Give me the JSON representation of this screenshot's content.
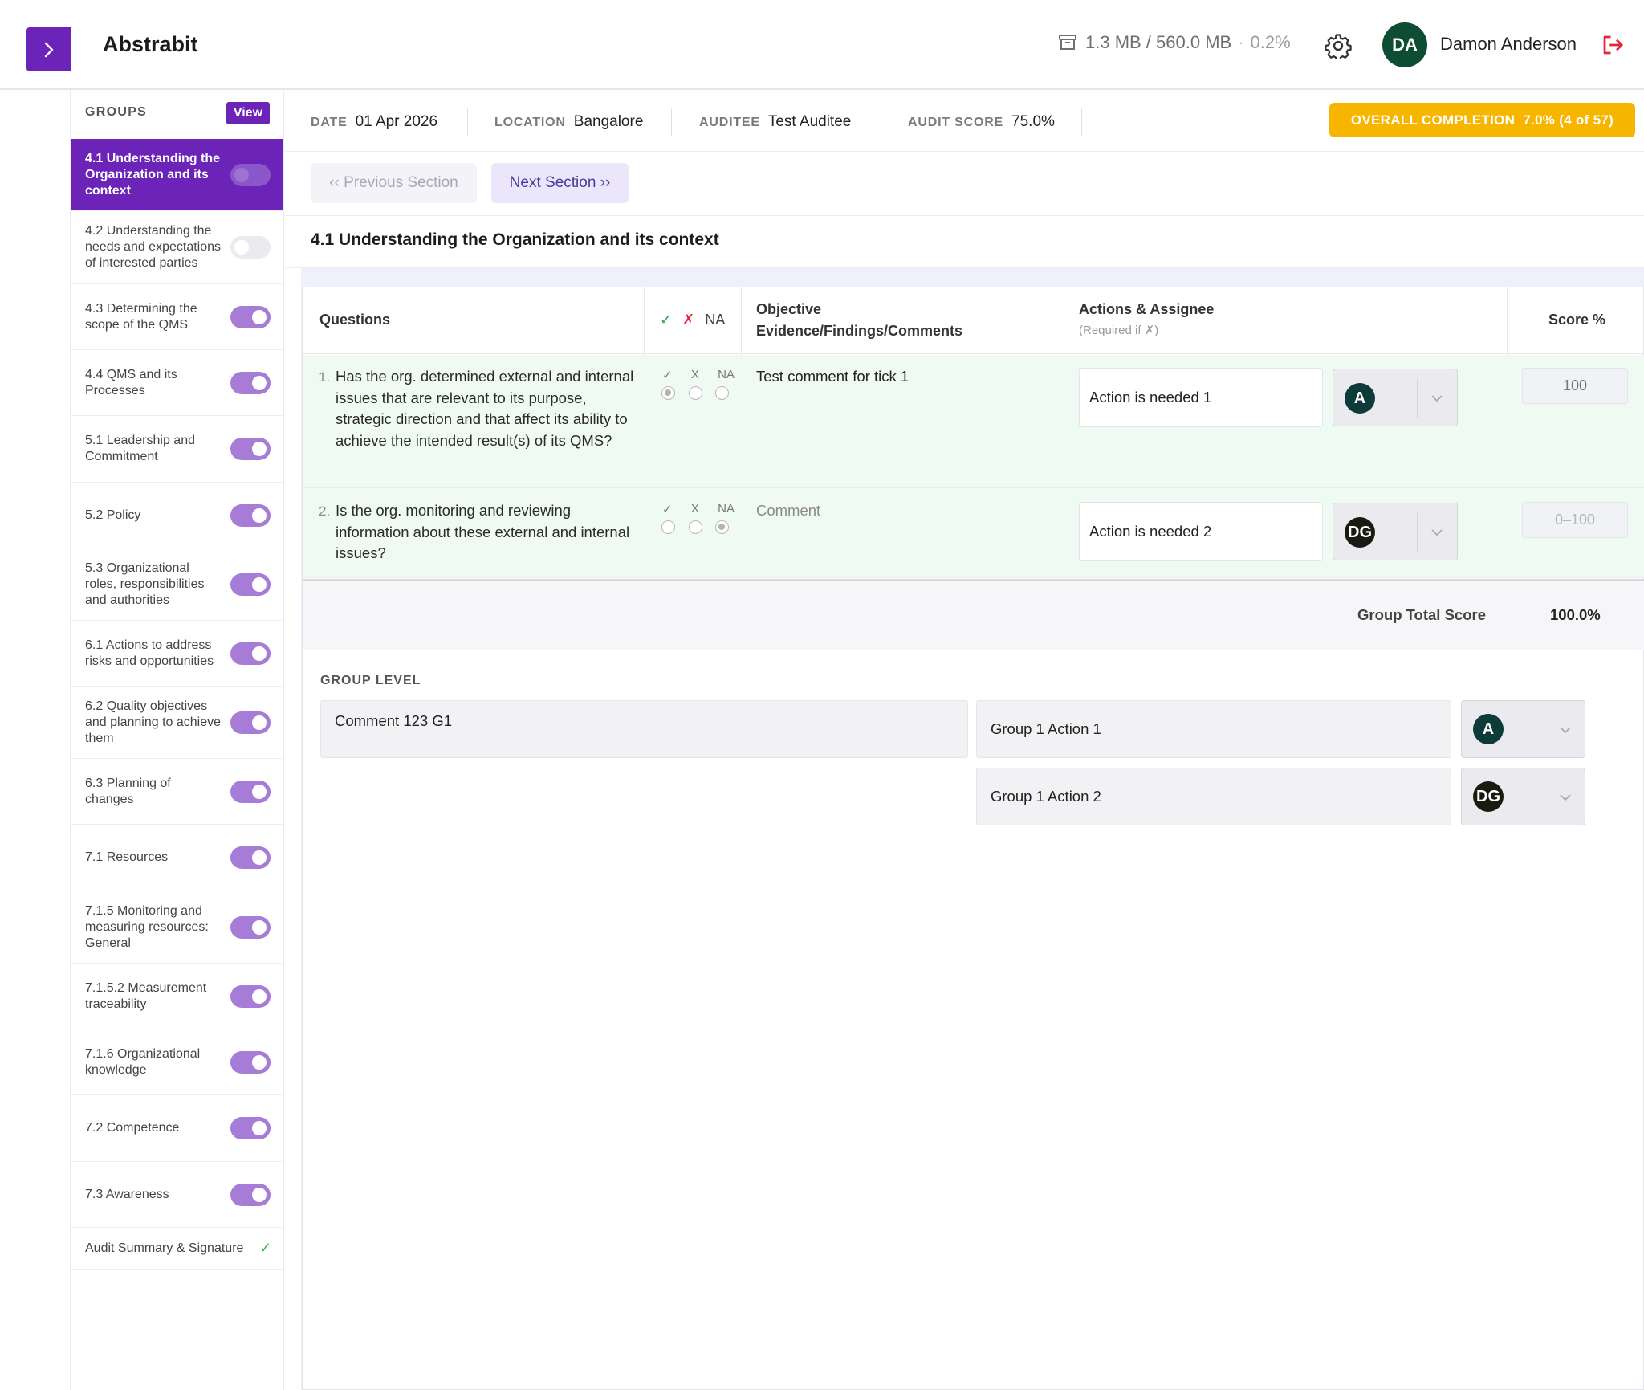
{
  "app": {
    "title": "Abstrabit"
  },
  "storage": {
    "used": "1.3 MB / 560.0 MB",
    "percent": "0.2%"
  },
  "user": {
    "initials": "DA",
    "name": "Damon Anderson",
    "avatar_color": "#0d4d33"
  },
  "colors": {
    "accent": "#6b23b8",
    "completion": "#f7b500",
    "row_bg": "#eefaf2"
  },
  "sidebar": {
    "heading": "GROUPS",
    "view_label": "View",
    "items": [
      {
        "label": "4.1 Understanding the Organization and its context",
        "enabled": false,
        "active": true
      },
      {
        "label": "4.2 Understanding the needs and expectations of interested parties",
        "enabled": false
      },
      {
        "label": "4.3 Determining the scope of the QMS",
        "enabled": true
      },
      {
        "label": "4.4 QMS and its Processes",
        "enabled": true
      },
      {
        "label": "5.1 Leadership and Commitment",
        "enabled": true
      },
      {
        "label": "5.2 Policy",
        "enabled": true
      },
      {
        "label": "5.3 Organizational roles, responsibilities and authorities",
        "enabled": true
      },
      {
        "label": "6.1 Actions to address risks and opportunities",
        "enabled": true
      },
      {
        "label": "6.2 Quality objectives and planning to achieve them",
        "enabled": true
      },
      {
        "label": "6.3 Planning of changes",
        "enabled": true
      },
      {
        "label": "7.1 Resources",
        "enabled": true
      },
      {
        "label": "7.1.5 Monitoring and measuring resources: General",
        "enabled": true
      },
      {
        "label": "7.1.5.2 Measurement traceability",
        "enabled": true
      },
      {
        "label": "7.1.6 Organizational knowledge",
        "enabled": true
      },
      {
        "label": "7.2 Competence",
        "enabled": true
      },
      {
        "label": "7.3 Awareness",
        "enabled": true
      }
    ],
    "summary": {
      "label": "Audit Summary & Signature",
      "check": "✓"
    }
  },
  "meta": {
    "date_label": "DATE",
    "date": "01 Apr 2026",
    "location_label": "LOCATION",
    "location": "Bangalore",
    "auditee_label": "AUDITEE",
    "auditee": "Test Auditee",
    "score_label": "AUDIT SCORE",
    "score": "75.0%",
    "completion": "OVERALL COMPLETION  7.0% (4 of 57)"
  },
  "nav": {
    "prev": "‹‹ Previous Section",
    "next": "Next Section ››"
  },
  "section": {
    "title": "4.1 Understanding the Organization and its context"
  },
  "table": {
    "col_questions": "Questions",
    "col_check": "✓",
    "col_cross": "✗",
    "col_na": "NA",
    "col_evidence": "Objective Evidence/Findings/Comments",
    "col_actions": "Actions & Assignee",
    "col_actions_note": "(Required if ✗)",
    "col_score": "Score %",
    "option_labels": {
      "yes": "✓",
      "no": "X",
      "na": "NA"
    },
    "rows": [
      {
        "num": "1.",
        "question": "Has the org. determined external and internal issues that are relevant to its purpose, strategic direction and that affect its ability to achieve the intended result(s) of its QMS?",
        "selected": "yes",
        "comment": "Test comment for tick 1",
        "comment_placeholder": "",
        "action": "Action is needed 1",
        "assignee": {
          "initials": "A",
          "color": "#0d3b3a"
        },
        "score": "100",
        "score_placeholder": ""
      },
      {
        "num": "2.",
        "question": "Is the org. monitoring and reviewing information about these external and internal issues?",
        "selected": "na",
        "comment": "",
        "comment_placeholder": "Comment",
        "action": "Action is needed 2",
        "assignee": {
          "initials": "DG",
          "color": "#1b1a10"
        },
        "score": "",
        "score_placeholder": "0–100"
      }
    ],
    "total_label": "Group Total Score",
    "total_value": "100.0%"
  },
  "group_level": {
    "title": "GROUP LEVEL",
    "comment": "Comment 123 G1",
    "actions": [
      {
        "label": "Group 1 Action 1",
        "assignee": {
          "initials": "A",
          "color": "#0d3b3a"
        }
      },
      {
        "label": "Group 1 Action 2",
        "assignee": {
          "initials": "DG",
          "color": "#1b1a10"
        }
      }
    ]
  }
}
